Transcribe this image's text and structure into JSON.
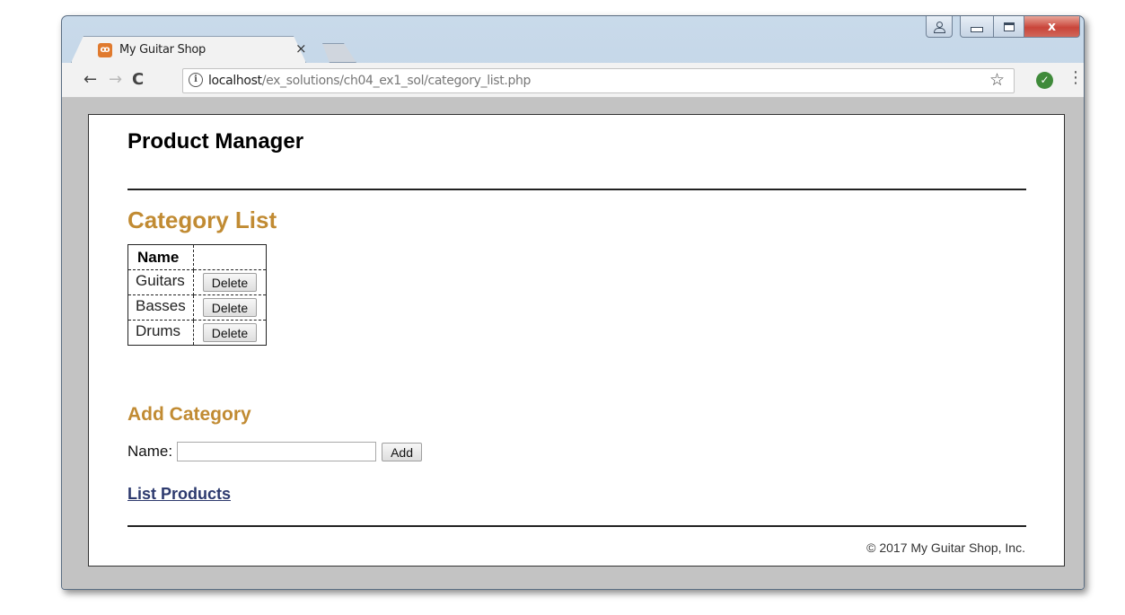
{
  "browser": {
    "tab": {
      "title": "My Guitar Shop",
      "favicon": "xampp-icon",
      "close_glyph": "×"
    },
    "window_controls": {
      "user": "user-icon",
      "minimize": "minimize-icon",
      "maximize": "maximize-icon",
      "close": "x"
    },
    "nav": {
      "back": "←",
      "forward": "→",
      "reload": "C"
    },
    "address": {
      "info_glyph": "i",
      "host": "localhost",
      "path": "/ex_solutions/ch04_ex1_sol/category_list.php"
    },
    "star_glyph": "☆",
    "extension_glyph": "✓",
    "menu_glyph": "⋮"
  },
  "page": {
    "header": {
      "title": "Product Manager"
    },
    "category_list": {
      "heading": "Category List",
      "columns": [
        "Name",
        ""
      ],
      "rows": [
        {
          "name": "Guitars",
          "action": "Delete"
        },
        {
          "name": "Basses",
          "action": "Delete"
        },
        {
          "name": "Drums",
          "action": "Delete"
        }
      ]
    },
    "add_category": {
      "heading": "Add Category",
      "name_label": "Name:",
      "name_value": "",
      "add_button": "Add"
    },
    "list_products_link": "List Products",
    "footer": "© 2017 My Guitar Shop, Inc."
  },
  "colors": {
    "heading_accent": "#c18b33",
    "link": "#2d3a6e"
  }
}
